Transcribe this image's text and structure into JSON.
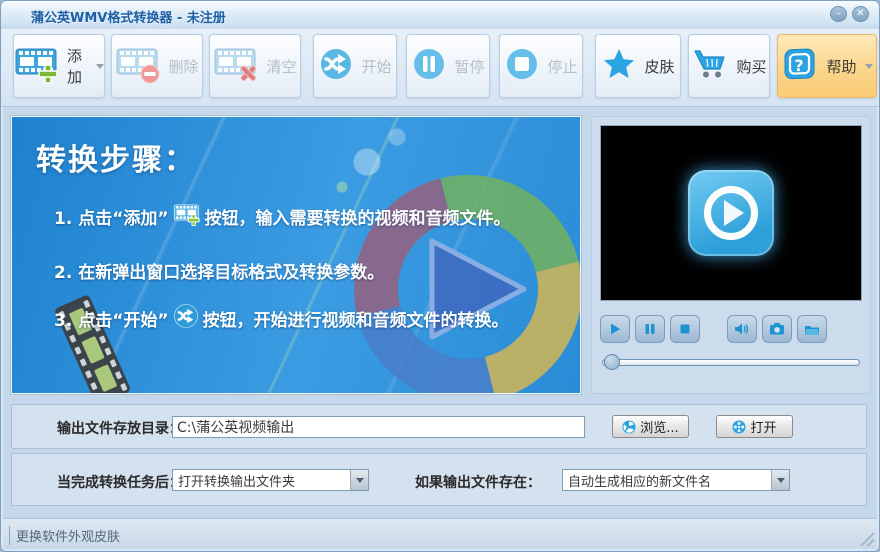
{
  "window": {
    "title": "蒲公英WMV格式转换器 - 未注册",
    "minimize_glyph": "–",
    "close_glyph": "✕"
  },
  "toolbar": {
    "add": {
      "label": "添加",
      "enabled": true,
      "icon": "filmstrip-plus-icon",
      "has_dropdown": true
    },
    "delete": {
      "label": "删除",
      "enabled": false,
      "icon": "filmstrip-minus-icon"
    },
    "clear": {
      "label": "清空",
      "enabled": false,
      "icon": "filmstrip-x-icon"
    },
    "start": {
      "label": "开始",
      "enabled": false,
      "icon": "convert-arrows-icon"
    },
    "pause": {
      "label": "暂停",
      "enabled": false,
      "icon": "pause-circle-icon"
    },
    "stop": {
      "label": "停止",
      "enabled": false,
      "icon": "stop-circle-icon"
    },
    "skin": {
      "label": "皮肤",
      "enabled": true,
      "icon": "star-icon"
    },
    "buy": {
      "label": "购买",
      "enabled": true,
      "icon": "cart-icon"
    },
    "help": {
      "label": "帮助",
      "enabled": true,
      "icon": "question-cube-icon",
      "has_dropdown": true,
      "highlighted": true
    }
  },
  "instructions": {
    "heading": "转换步骤：",
    "step1_prefix": "1. 点击“添加”",
    "step1_suffix": "按钮，输入需要转换的视频和音频文件。",
    "step2": "2. 在新弹出窗口选择目标格式及转换参数。",
    "step3_prefix": "3. 点击“开始”",
    "step3_suffix": "按钮，开始进行视频和音频文件的转换。"
  },
  "player": {
    "buttons": [
      "play-icon",
      "pause-icon",
      "stop-icon",
      "volume-icon",
      "snapshot-camera-icon",
      "folder-icon"
    ],
    "seek_position": 0
  },
  "output": {
    "dir_label": "输出文件存放目录：",
    "dir_value": "C:\\蒲公英视频输出",
    "browse_label": "浏览...",
    "open_label": "打开"
  },
  "options": {
    "after_label": "当完成转换任务后：",
    "after_value": "打开转换输出文件夹",
    "exists_label": "如果输出文件存在：",
    "exists_value": "自动生成相应的新文件名"
  },
  "statusbar": {
    "text": "更换软件外观皮肤"
  },
  "colors": {
    "accent_blue": "#2da0e0",
    "panel_blue": "#2f8fd8",
    "help_orange": "#fbd488",
    "window_bg": "#c5d8ea",
    "titlebar_text": "#1c5fa4",
    "disabled_text": "#b3bfca",
    "ring_purple": "#9a5f7d",
    "ring_green": "#74b35a",
    "ring_yellow": "#d9b850",
    "ring_blue": "#4a7ec9"
  }
}
